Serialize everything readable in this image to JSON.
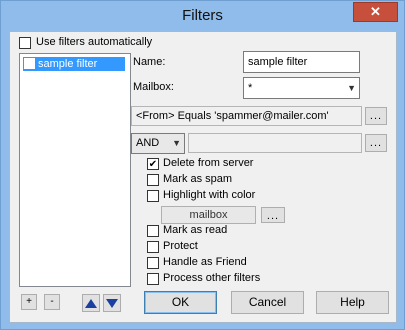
{
  "window": {
    "title": "Filters",
    "close_glyph": "✕"
  },
  "top": {
    "use_filters_auto_label": "Use filters automatically",
    "use_filters_auto_checked": false
  },
  "filter_list": {
    "items": [
      {
        "label": "sample filter",
        "checked": false,
        "selected": true
      }
    ]
  },
  "form": {
    "name_label": "Name:",
    "name_value": "sample filter",
    "mailbox_label": "Mailbox:",
    "mailbox_value": "*",
    "condition_text": "<From> Equals 'spammer@mailer.com'",
    "dots": "...",
    "operator_value": "AND",
    "condition2_text": ""
  },
  "actions": [
    {
      "label": "Delete from server",
      "checked": true
    },
    {
      "label": "Mark as spam",
      "checked": false
    },
    {
      "label": "Highlight with color",
      "checked": false
    },
    {
      "label": "Mark as read",
      "checked": false
    },
    {
      "label": "Protect",
      "checked": false
    },
    {
      "label": "Handle as Friend",
      "checked": false
    },
    {
      "label": "Process other filters",
      "checked": false
    }
  ],
  "highlight": {
    "color_value": "mailbox"
  },
  "list_buttons": {
    "add": "+",
    "remove": "-"
  },
  "buttons": {
    "ok": "OK",
    "cancel": "Cancel",
    "help": "Help"
  }
}
